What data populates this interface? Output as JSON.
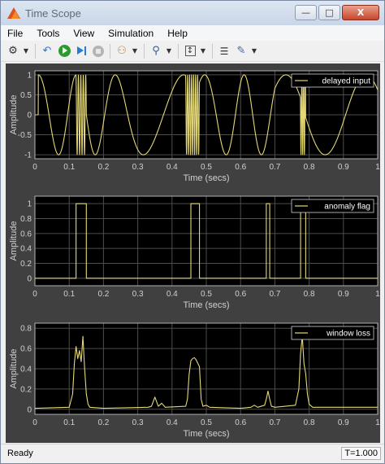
{
  "window": {
    "title": "Time Scope",
    "minimize": "—",
    "maximize": "□",
    "close": "X"
  },
  "menu": [
    "File",
    "Tools",
    "View",
    "Simulation",
    "Help"
  ],
  "toolbar": {
    "icons": [
      "gear-icon",
      "back-icon",
      "run-icon",
      "step-forward-icon",
      "stop-icon",
      "highlight-blocks-icon",
      "zoom-icon",
      "scale-axes-icon",
      "legend-icon",
      "triggers-icon"
    ]
  },
  "status": {
    "text": "Ready",
    "time": "T=1.000"
  },
  "colors": {
    "plot_bg": "#000000",
    "figure_bg": "#404040",
    "axis": "#d0d0d0",
    "grid": "#4d4d4d",
    "trace": "#e5d876"
  },
  "chart_data": [
    {
      "type": "line",
      "ylabel": "Amplitude",
      "xlabel": "Time (secs)",
      "xlim": [
        0,
        1
      ],
      "ylim": [
        -1.1,
        1.1
      ],
      "xticks": [
        "0",
        "0.1",
        "0.2",
        "0.3",
        "0.4",
        "0.5",
        "0.6",
        "0.7",
        "0.8",
        "0.9",
        "1"
      ],
      "yticks": [
        "-1",
        "-0.5",
        "0",
        "0.5",
        "1"
      ],
      "grid": true,
      "legend": {
        "placement": "top-right",
        "entries": [
          "delayed input"
        ]
      },
      "series": [
        {
          "name": "delayed input",
          "signal": "chirp-with-bursts"
        }
      ]
    },
    {
      "type": "line",
      "ylabel": "Amplitude",
      "xlabel": "Time (secs)",
      "xlim": [
        0,
        1
      ],
      "ylim": [
        -0.1,
        1.1
      ],
      "xticks": [
        "0",
        "0.1",
        "0.2",
        "0.3",
        "0.4",
        "0.5",
        "0.6",
        "0.7",
        "0.8",
        "0.9",
        "1"
      ],
      "yticks": [
        "0",
        "0.2",
        "0.4",
        "0.6",
        "0.8",
        "1"
      ],
      "grid": true,
      "legend": {
        "placement": "top-right",
        "entries": [
          "anomaly flag"
        ]
      },
      "series": [
        {
          "name": "anomaly flag",
          "x": [
            0,
            0.12,
            0.12,
            0.15,
            0.15,
            0.455,
            0.455,
            0.48,
            0.48,
            0.675,
            0.675,
            0.685,
            0.685,
            0.775,
            0.775,
            0.79,
            0.79,
            1
          ],
          "y": [
            0,
            0,
            1,
            1,
            0,
            0,
            1,
            1,
            0,
            0,
            1,
            1,
            0,
            0,
            1,
            1,
            0,
            0
          ]
        }
      ]
    },
    {
      "type": "line",
      "ylabel": "Amplitude",
      "xlabel": "Time (secs)",
      "xlim": [
        0,
        1
      ],
      "ylim": [
        -0.05,
        0.85
      ],
      "xticks": [
        "0",
        "0.1",
        "0.2",
        "0.3",
        "0.4",
        "0.5",
        "0.6",
        "0.7",
        "0.8",
        "0.9",
        "1"
      ],
      "yticks": [
        "0",
        "0.2",
        "0.4",
        "0.6",
        "0.8"
      ],
      "grid": true,
      "legend": {
        "placement": "top-right",
        "entries": [
          "window loss"
        ]
      },
      "series": [
        {
          "name": "window loss",
          "x": [
            0,
            0.1,
            0.11,
            0.115,
            0.12,
            0.125,
            0.13,
            0.135,
            0.14,
            0.145,
            0.15,
            0.155,
            0.16,
            0.2,
            0.33,
            0.34,
            0.35,
            0.36,
            0.37,
            0.38,
            0.44,
            0.445,
            0.45,
            0.455,
            0.46,
            0.465,
            0.47,
            0.48,
            0.485,
            0.49,
            0.5,
            0.51,
            0.6,
            0.63,
            0.64,
            0.65,
            0.67,
            0.675,
            0.68,
            0.685,
            0.69,
            0.7,
            0.76,
            0.77,
            0.775,
            0.78,
            0.785,
            0.79,
            0.795,
            0.8,
            0.81,
            1
          ],
          "y": [
            0.01,
            0.02,
            0.15,
            0.45,
            0.62,
            0.5,
            0.58,
            0.47,
            0.72,
            0.4,
            0.15,
            0.05,
            0.02,
            0.01,
            0.02,
            0.03,
            0.12,
            0.03,
            0.06,
            0.02,
            0.03,
            0.1,
            0.35,
            0.48,
            0.5,
            0.51,
            0.49,
            0.42,
            0.1,
            0.03,
            0.04,
            0.02,
            0.01,
            0.02,
            0.04,
            0.02,
            0.04,
            0.1,
            0.18,
            0.1,
            0.03,
            0.02,
            0.04,
            0.2,
            0.55,
            0.72,
            0.45,
            0.35,
            0.15,
            0.05,
            0.02,
            0.02
          ]
        }
      ]
    }
  ]
}
